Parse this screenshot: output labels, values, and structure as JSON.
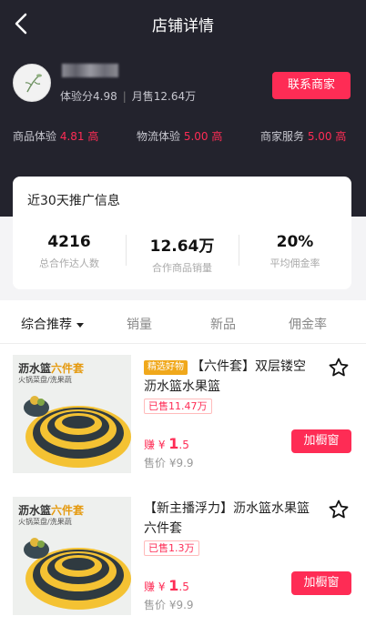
{
  "header": {
    "title": "店铺详情"
  },
  "shop": {
    "stats_score": "体验分4.98",
    "stats_sales": "月售12.64万",
    "contact_label": "联系商家",
    "ratings": [
      {
        "label": "商品体验",
        "value": "4.81",
        "level": "高"
      },
      {
        "label": "物流体验",
        "value": "5.00",
        "level": "高"
      },
      {
        "label": "商家服务",
        "value": "5.00",
        "level": "高"
      }
    ]
  },
  "promo": {
    "title": "近30天推广信息",
    "stats": [
      {
        "value": "4216",
        "label": "总合作达人数"
      },
      {
        "value": "12.64万",
        "label": "合作商品销量"
      },
      {
        "value": "20%",
        "label": "平均佣金率"
      }
    ]
  },
  "sort": [
    "综合推荐",
    "销量",
    "新品",
    "佣金率"
  ],
  "products": [
    {
      "tag": "精选好物",
      "name": "【六件套】双层镂空沥水篮水果篮",
      "sold": "已售11.47万",
      "earn_prefix": "赚 ¥",
      "earn_int": "1",
      "earn_dec": ".5",
      "price": "售价 ¥9.9",
      "add_label": "加橱窗",
      "thumb_title_a": "沥水篮",
      "thumb_title_b": "六件套",
      "thumb_sub": "火锅菜盘/洗果蔬"
    },
    {
      "tag": "",
      "name": "【新主播浮力】沥水篮水果篮六件套",
      "sold": "已售1.3万",
      "earn_prefix": "赚 ¥",
      "earn_int": "1",
      "earn_dec": ".5",
      "price": "售价 ¥9.9",
      "add_label": "加橱窗",
      "thumb_title_a": "沥水篮",
      "thumb_title_b": "六件套",
      "thumb_sub": "火锅菜盘/洗果蔬"
    }
  ],
  "colors": {
    "accent": "#fe2c55",
    "header_bg": "#23232d",
    "tag_bg": "#f0a81b"
  }
}
